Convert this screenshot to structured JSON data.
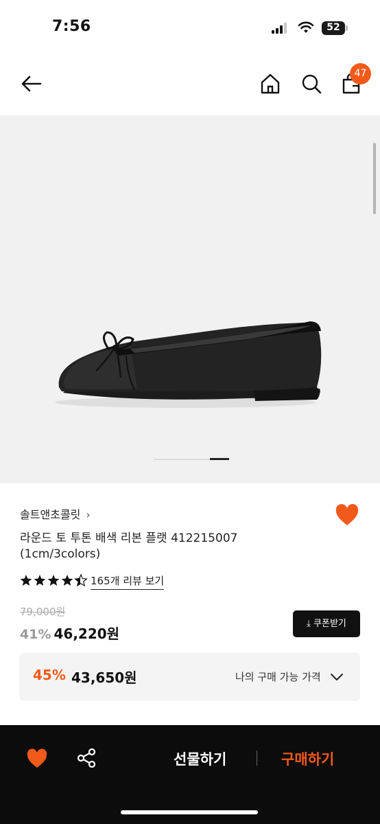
{
  "status_bar": {
    "time": "7:56",
    "battery_level": "52"
  },
  "nav": {
    "back_icon": "arrow-left-icon",
    "home_icon": "home-icon",
    "search_icon": "search-icon",
    "bag_icon": "shopping-bag-icon",
    "bag_badge": "47"
  },
  "hero": {
    "image": "black ballet flat shoe with bow",
    "slide_index": 2,
    "slide_count": 2
  },
  "product": {
    "brand": "솔트앤초콜릿",
    "brand_chevron": "›",
    "title_line1": "라운드 토 투톤 배색 리본 플랫 412215007",
    "title_line2": "(1cm/3colors)",
    "rating": 4.5,
    "review_link": "165개 리뷰 보기",
    "original_price": "79,000원",
    "discount_pct": "41%",
    "sale_price": "46,220원",
    "coupon_button": "⤓ 쿠폰받기",
    "best_discount_pct": "45%",
    "best_price": "43,650원",
    "best_price_label": "나의 구매 가능 가격"
  },
  "bottom_bar": {
    "gift_label": "선물하기",
    "buy_label": "구매하기"
  },
  "colors": {
    "accent": "#f25a1c",
    "dark": "#0c0c0c"
  }
}
